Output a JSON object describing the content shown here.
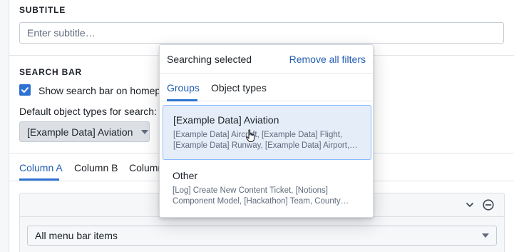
{
  "subtitle": {
    "label": "SUBTITLE",
    "placeholder": "Enter subtitle…"
  },
  "search_bar": {
    "label": "SEARCH BAR",
    "checkbox_label": "Show search bar on homepage",
    "checked": true,
    "default_types_label": "Default object types for search:",
    "selected_value": "[Example Data] Aviation"
  },
  "tabs": [
    {
      "label": "Column A",
      "active": true
    },
    {
      "label": "Column B",
      "active": false
    },
    {
      "label": "Column C",
      "active": false
    }
  ],
  "menu_select": {
    "value": "All menu bar items"
  },
  "popover": {
    "title": "Searching selected",
    "remove_link": "Remove all filters",
    "tabs": [
      {
        "label": "Groups",
        "active": true
      },
      {
        "label": "Object types",
        "active": false
      }
    ],
    "groups": [
      {
        "title": "[Example Data] Aviation",
        "description": "[Example Data] Aircraft, [Example Data] Flight, [Example Data] Runway, [Example Data] Airport, [Example Data] Airline",
        "selected": true
      },
      {
        "title": "Other",
        "description": "[Log] Create New Content Ticket, [Notions] Component Model, [Hackathon] Team, County Data, [Example] Other",
        "selected": false
      }
    ]
  },
  "colors": {
    "accent": "#2d72d2",
    "link": "#215db0",
    "selected_bg": "#e5edf8"
  }
}
